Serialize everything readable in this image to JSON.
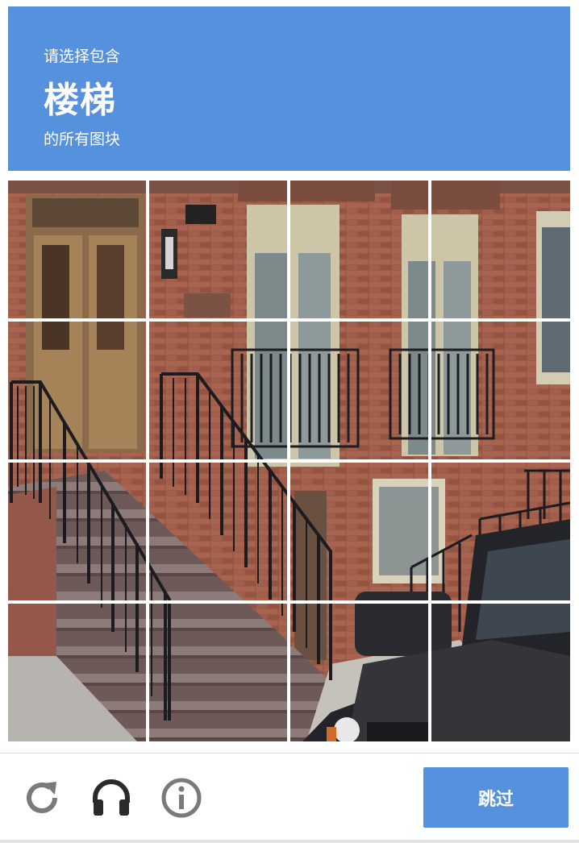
{
  "header": {
    "prefix": "请选择包含",
    "target": "楼梯",
    "suffix": "的所有图块"
  },
  "grid": {
    "rows": 4,
    "cols": 4,
    "subject": "brick townhouse with stoop stairs and black railings, parked car"
  },
  "footer": {
    "reload_icon": "reload-icon",
    "audio_icon": "headphones-icon",
    "info_icon": "info-icon",
    "skip_label": "跳过"
  },
  "colors": {
    "accent": "#5591dd",
    "icon_gray": "#7a7a7a",
    "icon_dark": "#2b2b2b"
  }
}
